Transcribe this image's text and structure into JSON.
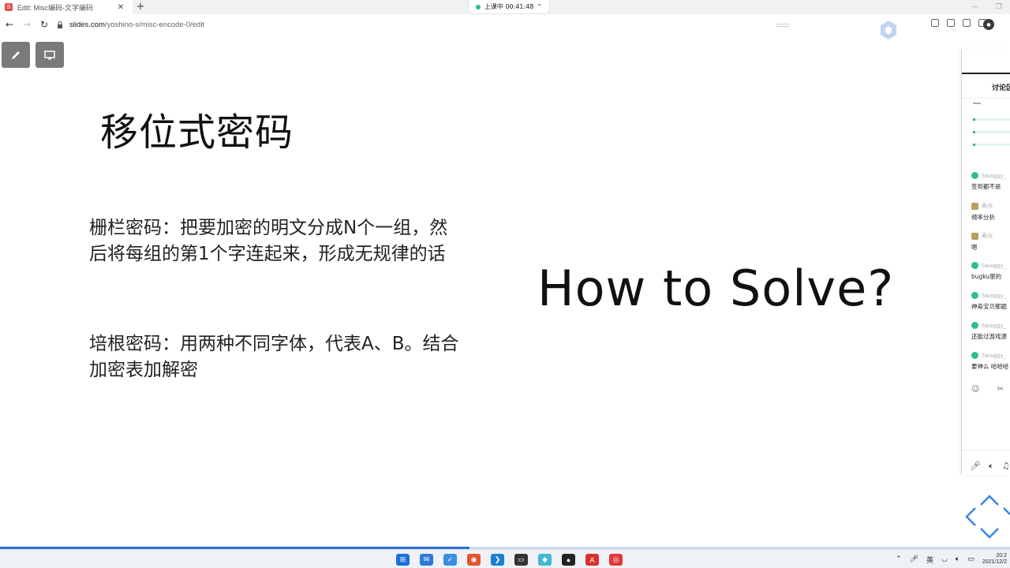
{
  "browser": {
    "tab_title": "Edit: Misc编码-文字编码",
    "tab_favicon_letter": "S",
    "live_status": "上课中 00:41:48",
    "url_host": "slides.com",
    "url_path": "/yoshino-s/misc-encode-0/edit"
  },
  "slide": {
    "title": "移位式密码",
    "para1": "栅栏密码：把要加密的明文分成N个一组，然后将每组的第1个字连起来，形成无规律的话",
    "para2": "培根密码：用两种不同字体，代表A、B。结合加密表加解密",
    "question": "How to Solve?"
  },
  "chat": {
    "header": "讨论区",
    "messages": [
      {
        "user": "Swaggy_",
        "text": "签到都不是"
      },
      {
        "user": "寿光",
        "text": "频率分析"
      },
      {
        "user": "寿光",
        "text": "嗯"
      },
      {
        "user": "Swaggy_",
        "text": "bugku里的"
      },
      {
        "user": "Swaggy_",
        "text": "神奇宝贝那题"
      },
      {
        "user": "Swaggy_",
        "text": "还能过游戏源"
      },
      {
        "user": "Swaggy_",
        "text": "要神么 哈哈哈"
      }
    ]
  },
  "progress": {
    "fraction": 0.465
  },
  "taskbar": {
    "ime": "英",
    "time": "20:2",
    "date": "2021/12/2"
  }
}
